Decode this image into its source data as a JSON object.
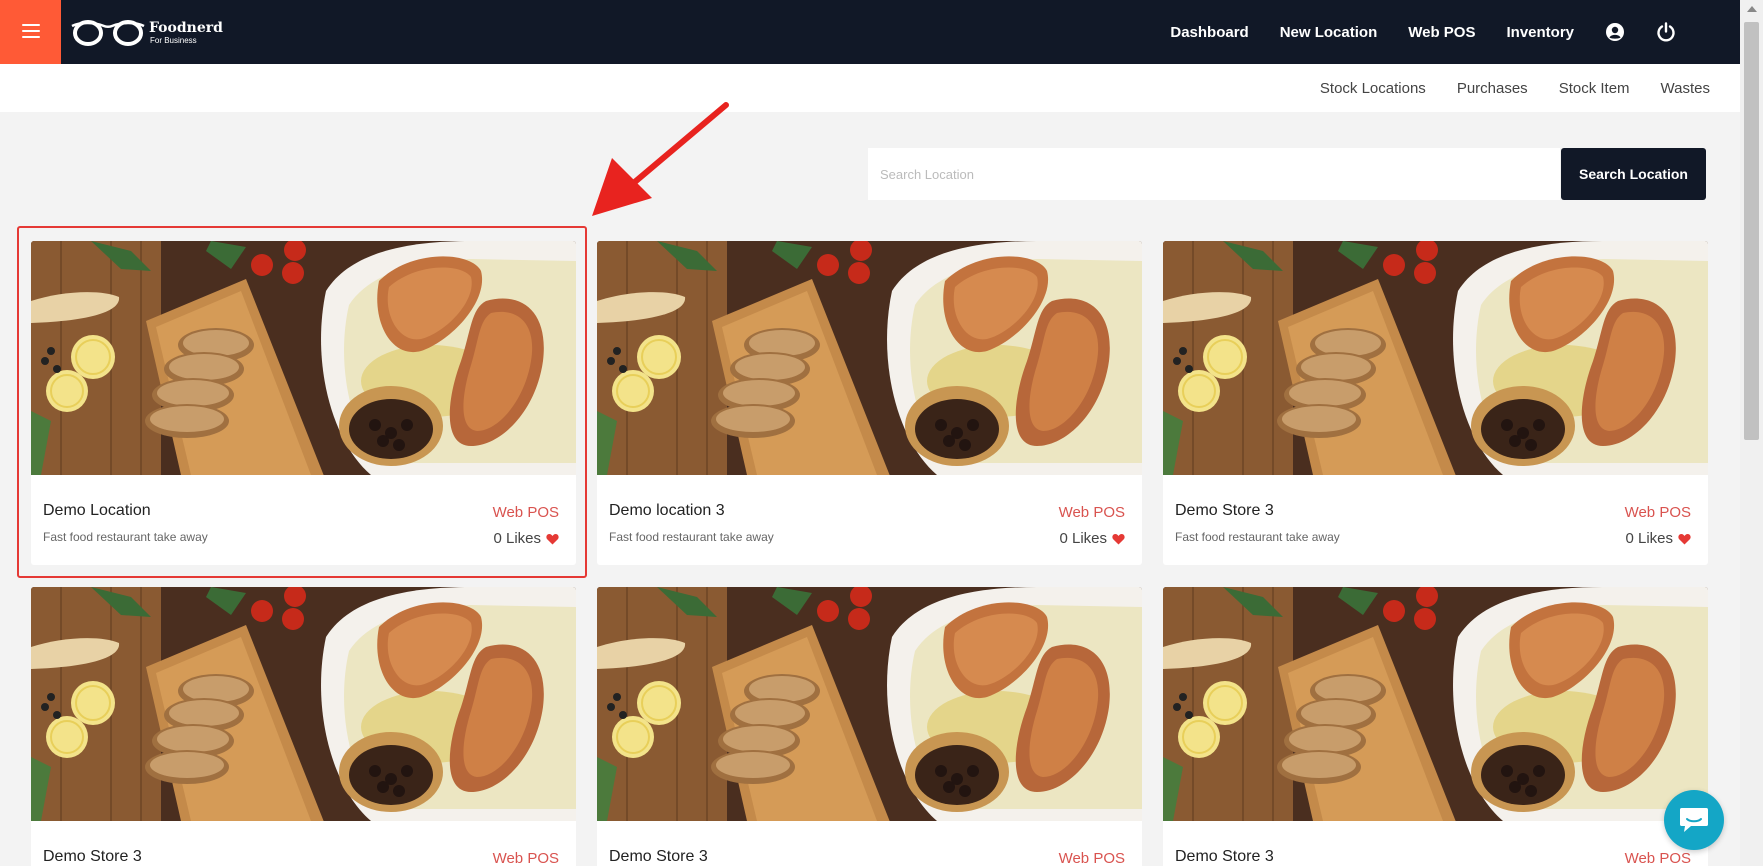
{
  "brand": {
    "name": "Foodnerd",
    "tagline": "For Business"
  },
  "topnav": {
    "items": [
      {
        "label": "Dashboard"
      },
      {
        "label": "New Location"
      },
      {
        "label": "Web POS"
      },
      {
        "label": "Inventory"
      }
    ]
  },
  "subnav": {
    "items": [
      {
        "label": "Stock Locations"
      },
      {
        "label": "Purchases"
      },
      {
        "label": "Stock Item"
      },
      {
        "label": "Wastes"
      }
    ]
  },
  "search": {
    "placeholder": "Search Location",
    "value": "",
    "button_label": "Search Location"
  },
  "locations": [
    {
      "title": "Demo Location",
      "description": "Fast food restaurant take away",
      "pos_label": "Web POS",
      "likes": "0 Likes"
    },
    {
      "title": "Demo location 3",
      "description": "Fast food restaurant take away",
      "pos_label": "Web POS",
      "likes": "0 Likes"
    },
    {
      "title": "Demo Store 3",
      "description": "Fast food restaurant take away",
      "pos_label": "Web POS",
      "likes": "0 Likes"
    },
    {
      "title": "Demo Store 3",
      "description": "",
      "pos_label": "Web POS",
      "likes": ""
    },
    {
      "title": "Demo Store 3",
      "description": "",
      "pos_label": "Web POS",
      "likes": ""
    },
    {
      "title": "Demo Store 3",
      "description": "",
      "pos_label": "Web POS",
      "likes": ""
    }
  ],
  "colors": {
    "topbar": "#111827",
    "accent": "#ff5a36",
    "link_red": "#d9534f",
    "heart": "#e53935",
    "chat": "#14a6c6"
  },
  "icons": [
    "menu-icon",
    "glasses-logo-icon",
    "user-circle-icon",
    "power-icon",
    "heart-icon",
    "chat-icon",
    "annotation-arrow"
  ]
}
